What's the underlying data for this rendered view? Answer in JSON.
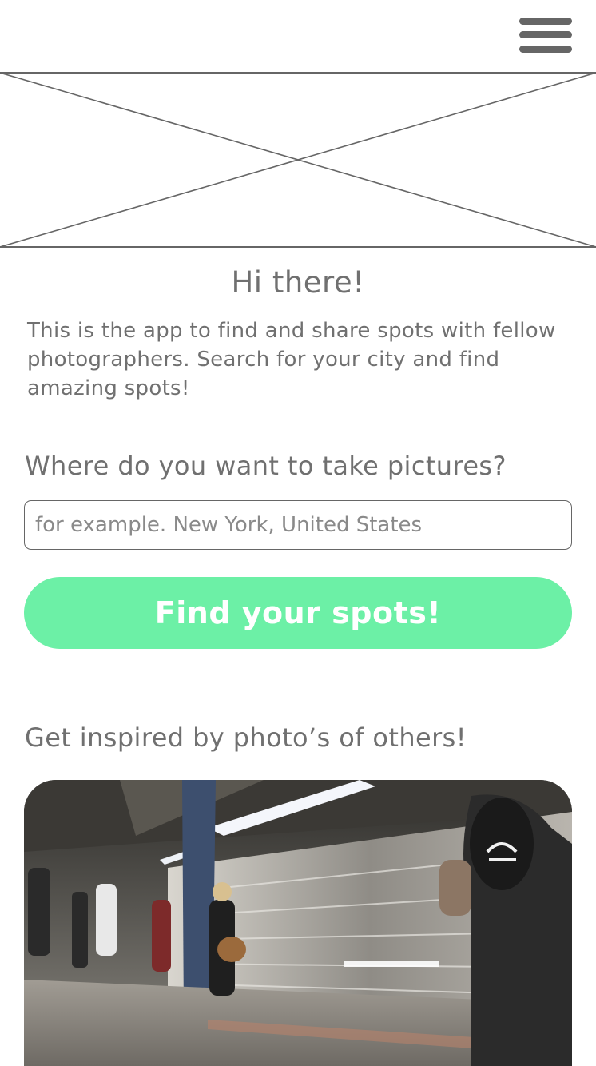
{
  "header": {
    "menu_icon": "hamburger-menu-icon"
  },
  "hero": {
    "placeholder_icon": "image-placeholder-icon"
  },
  "welcome": {
    "title": "Hi there!",
    "text": "This is the app to find and share spots with fellow photographers. Search for your city and find amazing spots!"
  },
  "search": {
    "question": "Where do you want to take pictures?",
    "placeholder": "for example. New York, United States",
    "value": "",
    "button_label": "Find your spots!"
  },
  "inspiration": {
    "heading": "Get inspired by photo’s of others!",
    "photo_alt": "Subway platform with a train speeding past"
  },
  "colors": {
    "accent": "#6cf0a6",
    "text": "#707070",
    "icon": "#666666"
  }
}
